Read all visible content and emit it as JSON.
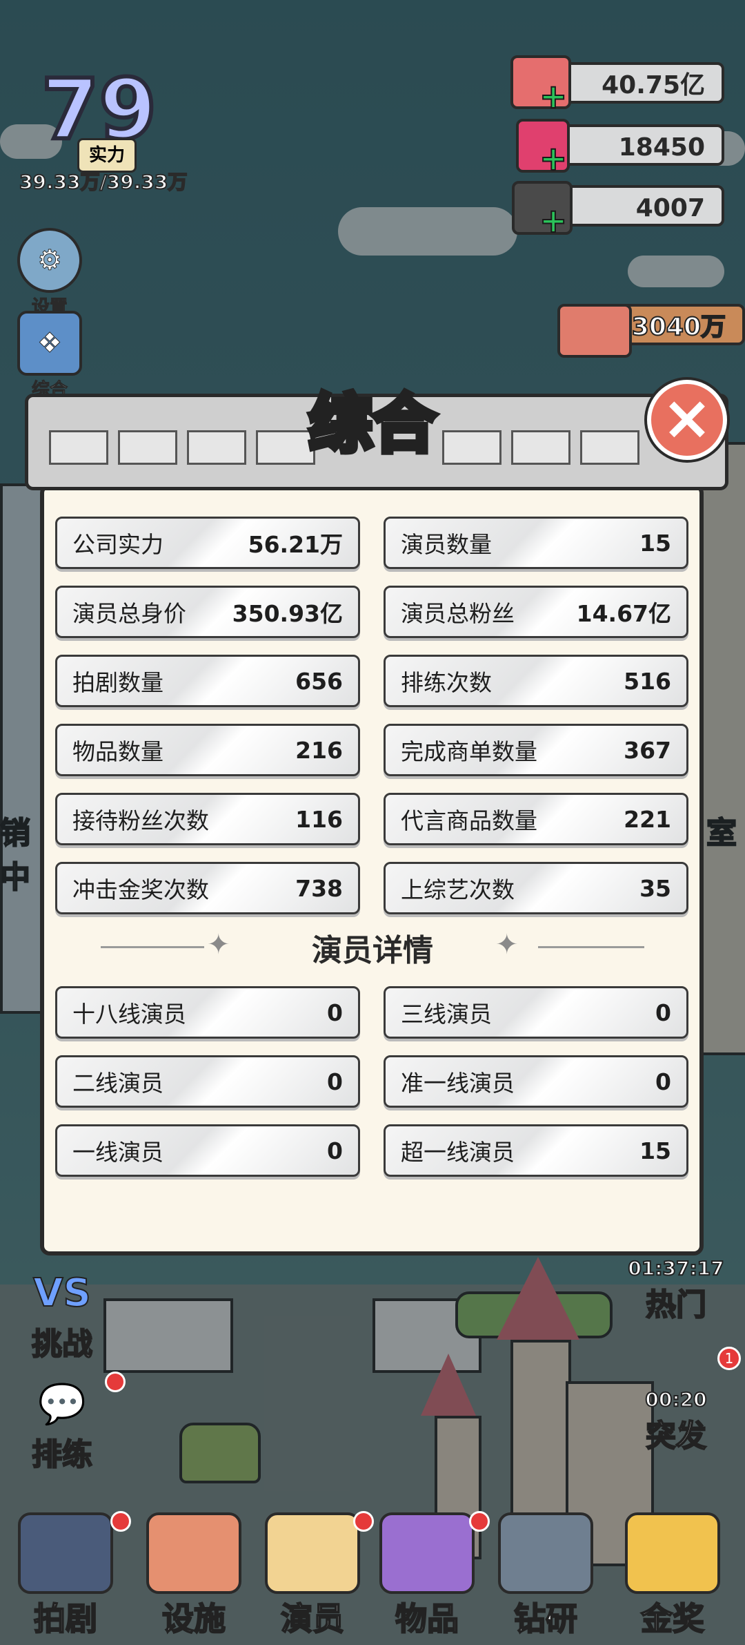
{
  "player": {
    "level": "79",
    "power_label": "实力",
    "power_progress": "39.33万/39.33万"
  },
  "side_buttons": [
    {
      "label": "设置",
      "icon": "gear-icon"
    },
    {
      "label": "综合",
      "icon": "book-icon"
    }
  ],
  "currency": {
    "cash": "40.75亿",
    "gems": "18450",
    "cards": "4007",
    "income": "3040万"
  },
  "modal": {
    "title": "综合",
    "stats": [
      {
        "label": "公司实力",
        "value": "56.21万"
      },
      {
        "label": "演员数量",
        "value": "15"
      },
      {
        "label": "演员总身价",
        "value": "350.93亿"
      },
      {
        "label": "演员总粉丝",
        "value": "14.67亿"
      },
      {
        "label": "拍剧数量",
        "value": "656"
      },
      {
        "label": "排练次数",
        "value": "516"
      },
      {
        "label": "物品数量",
        "value": "216"
      },
      {
        "label": "完成商单数量",
        "value": "367"
      },
      {
        "label": "接待粉丝次数",
        "value": "116"
      },
      {
        "label": "代言商品数量",
        "value": "221"
      },
      {
        "label": "冲击金奖次数",
        "value": "738"
      },
      {
        "label": "上综艺次数",
        "value": "35"
      }
    ],
    "details_title": "演员详情",
    "details": [
      {
        "label": "十八线演员",
        "value": "0"
      },
      {
        "label": "三线演员",
        "value": "0"
      },
      {
        "label": "二线演员",
        "value": "0"
      },
      {
        "label": "准一线演员",
        "value": "0"
      },
      {
        "label": "一线演员",
        "value": "0"
      },
      {
        "label": "超一线演员",
        "value": "15"
      }
    ]
  },
  "background_labels": {
    "left_sign": "销中",
    "right_sign": "室"
  },
  "right_buttons": [
    {
      "timer": "01:37:17",
      "label": "热门"
    },
    {
      "timer": "00:20",
      "label": "突发",
      "badge": "1"
    }
  ],
  "left_buttons": [
    {
      "label": "挑战"
    },
    {
      "label": "排练"
    }
  ],
  "bottom_nav": [
    {
      "label": "拍剧"
    },
    {
      "label": "设施"
    },
    {
      "label": "演员"
    },
    {
      "label": "物品"
    },
    {
      "label": "钻研"
    },
    {
      "label": "金奖"
    }
  ]
}
